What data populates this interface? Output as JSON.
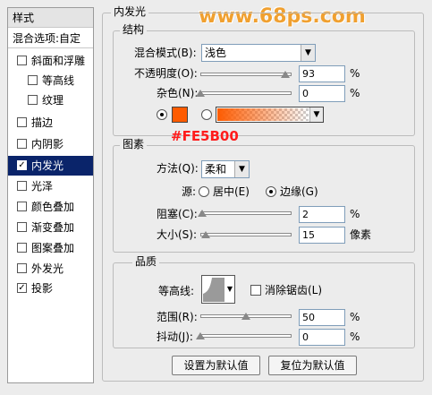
{
  "sidebar": {
    "title": "样式",
    "blend_options": "混合选项:自定",
    "items": [
      {
        "label": "斜面和浮雕",
        "checked": false
      },
      {
        "label": "等高线",
        "checked": false
      },
      {
        "label": "纹理",
        "checked": false
      },
      {
        "label": "描边",
        "checked": false
      },
      {
        "label": "内阴影",
        "checked": false
      },
      {
        "label": "内发光",
        "checked": true
      },
      {
        "label": "光泽",
        "checked": false
      },
      {
        "label": "颜色叠加",
        "checked": false
      },
      {
        "label": "渐变叠加",
        "checked": false
      },
      {
        "label": "图案叠加",
        "checked": false
      },
      {
        "label": "外发光",
        "checked": false
      },
      {
        "label": "投影",
        "checked": true
      }
    ]
  },
  "watermark": "www.68ps.com",
  "panel_title": "内发光",
  "structure": {
    "title": "结构",
    "blend_mode_label": "混合模式(B):",
    "blend_mode_value": "浅色",
    "opacity_label": "不透明度(O):",
    "opacity_value": "93",
    "opacity_fraction": 0.93,
    "noise_label": "杂色(N):",
    "noise_value": "0",
    "noise_fraction": 0.0,
    "percent": "%",
    "color_hex": "#FE5B00",
    "color_annotation": "#FE5B00"
  },
  "elements": {
    "title": "图素",
    "method_label": "方法(Q):",
    "method_value": "柔和",
    "source_label": "源:",
    "source_center": "居中(E)",
    "source_edge": "边缘(G)",
    "choke_label": "阻塞(C):",
    "choke_value": "2",
    "choke_fraction": 0.02,
    "size_label": "大小(S):",
    "size_value": "15",
    "size_fraction": 0.06,
    "size_unit": "像素",
    "percent": "%"
  },
  "quality": {
    "title": "品质",
    "contour_label": "等高线:",
    "anti_alias_label": "消除锯齿(L)",
    "range_label": "范围(R):",
    "range_value": "50",
    "range_fraction": 0.5,
    "jitter_label": "抖动(J):",
    "jitter_value": "0",
    "jitter_fraction": 0.0,
    "percent": "%"
  },
  "buttons": {
    "make_default": "设置为默认值",
    "reset_default": "复位为默认值"
  },
  "colors": {
    "accent": "#FE5B00",
    "selection": "#0a246a",
    "watermark": "#f0a030"
  }
}
